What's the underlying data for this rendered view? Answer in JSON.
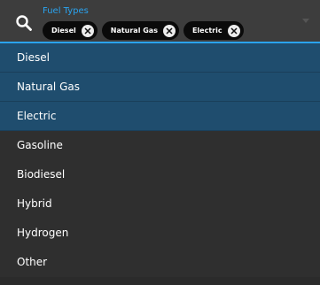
{
  "field": {
    "label": "Fuel Types",
    "icon": "search-icon",
    "accent_color": "#2aa3ef",
    "chips": [
      {
        "label": "Diesel",
        "icon": "close-icon"
      },
      {
        "label": "Natural Gas",
        "icon": "close-icon"
      },
      {
        "label": "Electric",
        "icon": "close-icon"
      }
    ]
  },
  "options": [
    {
      "label": "Diesel",
      "selected": true
    },
    {
      "label": "Natural Gas",
      "selected": true
    },
    {
      "label": "Electric",
      "selected": true
    },
    {
      "label": "Gasoline",
      "selected": false
    },
    {
      "label": "Biodiesel",
      "selected": false
    },
    {
      "label": "Hybrid",
      "selected": false
    },
    {
      "label": "Hydrogen",
      "selected": false
    },
    {
      "label": "Other",
      "selected": false
    }
  ],
  "colors": {
    "selected_row": "#1f4d6e",
    "list_background": "#2f2f2f",
    "chip_background": "#0a0a0a"
  }
}
